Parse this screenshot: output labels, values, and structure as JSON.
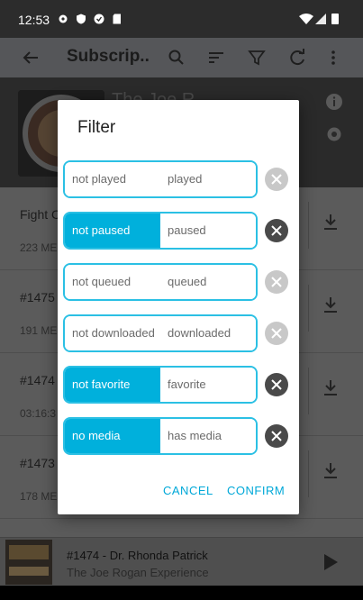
{
  "status_bar": {
    "time": "12:53"
  },
  "toolbar": {
    "title": "Subscrip..."
  },
  "header": {
    "podcast_title": "The Joe R..."
  },
  "episodes": [
    {
      "title": "Fight C...",
      "meta": "223 ME"
    },
    {
      "title": "#1475",
      "meta": "191 ME"
    },
    {
      "title": "#1474",
      "meta": "03:16:3"
    },
    {
      "title": "#1473",
      "meta": "178 ME"
    }
  ],
  "player": {
    "title": "#1474 - Dr. Rhonda Patrick",
    "subtitle": "The Joe Rogan Experience"
  },
  "dialog": {
    "title": "Filter",
    "filters": [
      {
        "left": "not played",
        "right": "played",
        "selected": "none"
      },
      {
        "left": "not paused",
        "right": "paused",
        "selected": "left"
      },
      {
        "left": "not queued",
        "right": "queued",
        "selected": "none"
      },
      {
        "left": "not downloaded",
        "right": "downloaded",
        "selected": "none"
      },
      {
        "left": "not favorite",
        "right": "favorite",
        "selected": "left"
      },
      {
        "left": "no media",
        "right": "has media",
        "selected": "left"
      }
    ],
    "cancel_label": "CANCEL",
    "confirm_label": "CONFIRM"
  },
  "colors": {
    "accent": "#00b0dc",
    "accent_border": "#2bc0e4",
    "clear_active": "#4a4a4a",
    "clear_inactive": "#c8c8c8"
  },
  "icons": {
    "toolbar": [
      "back-arrow-icon",
      "search-icon",
      "sort-icon",
      "filter-icon",
      "refresh-icon",
      "more-vert-icon"
    ],
    "status": [
      "settings-icon",
      "shield-icon",
      "app-icon",
      "sd-card-icon",
      "wifi-icon",
      "signal-icon",
      "battery-icon"
    ],
    "episode": "download-icon",
    "player": "play-icon",
    "header": [
      "info-icon",
      "gear-icon"
    ],
    "filter_clear": "close-circle-icon"
  }
}
